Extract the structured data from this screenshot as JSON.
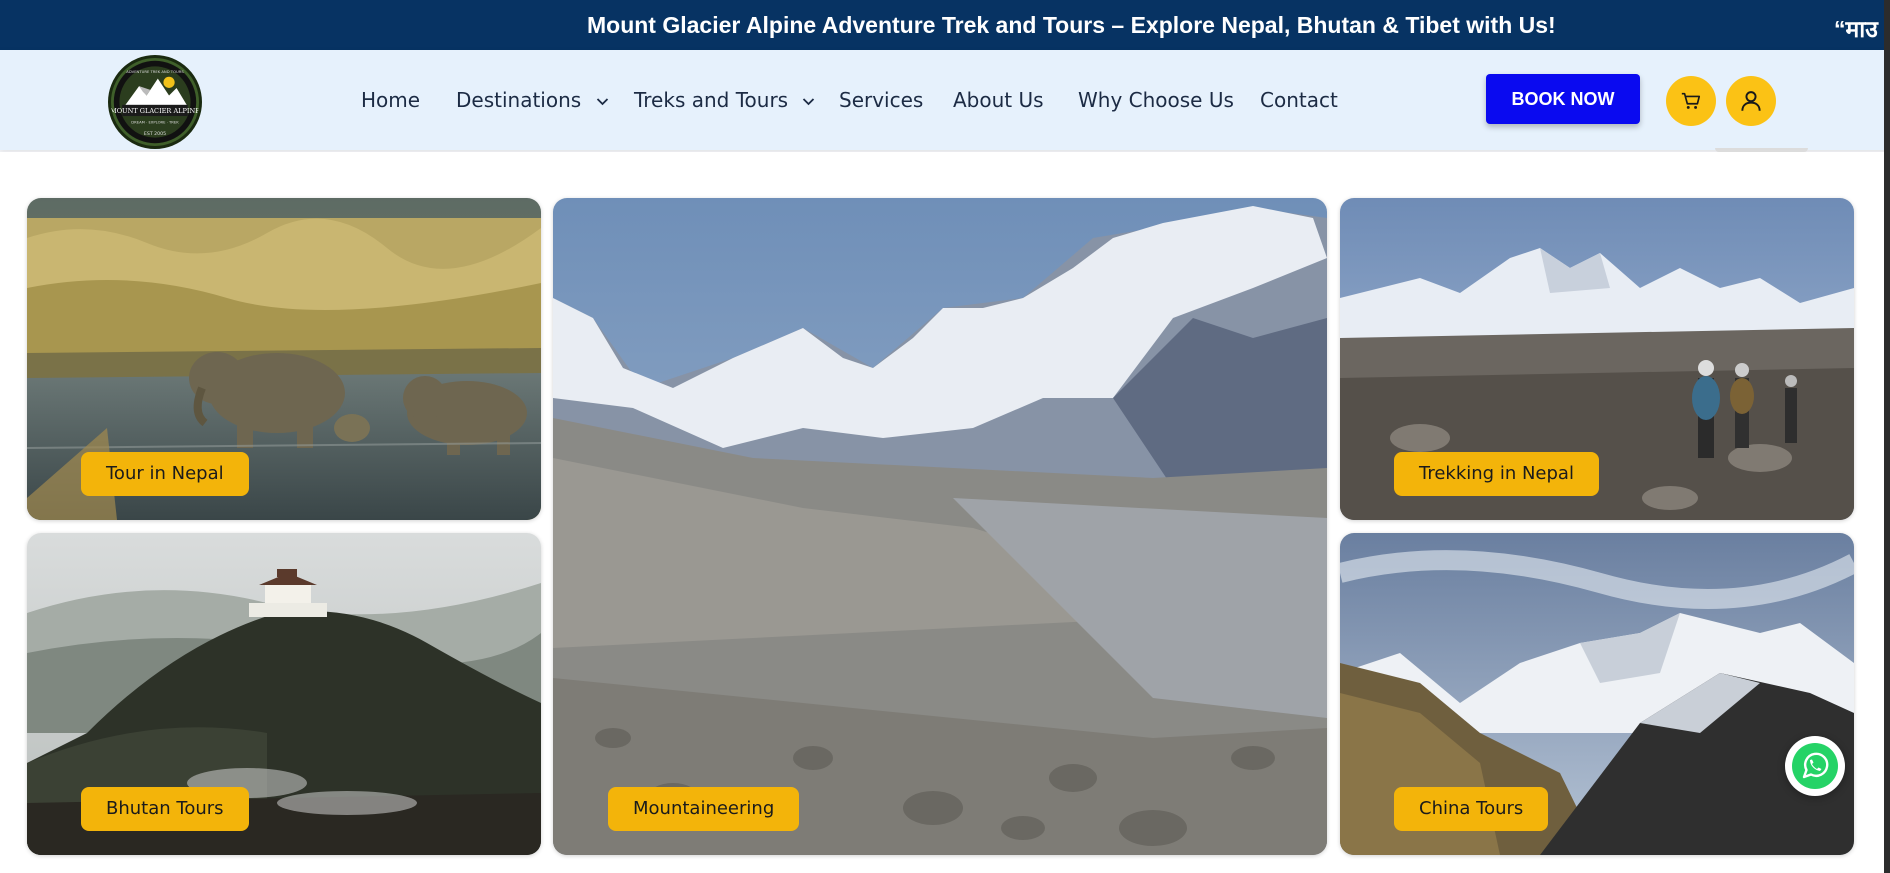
{
  "announcement": {
    "text": "Mount Glacier Alpine Adventure Trek and Tours – Explore Nepal, Bhutan & Tibet with Us!",
    "next_text": "“माउ"
  },
  "logo": {
    "top_text": "ADVENTURE TREK AND TOURS",
    "name": "MOUNT GLACIER ALPINE",
    "tagline": "DREAM · EXPLORE · TREK",
    "est": "EST 2005"
  },
  "nav": {
    "items": [
      {
        "label": "Home",
        "has_dropdown": false
      },
      {
        "label": "Destinations",
        "has_dropdown": true
      },
      {
        "label": "Treks and Tours",
        "has_dropdown": true
      },
      {
        "label": "Services",
        "has_dropdown": false
      },
      {
        "label": "About Us",
        "has_dropdown": false
      },
      {
        "label": "Why Choose Us",
        "has_dropdown": false
      },
      {
        "label": "Contact",
        "has_dropdown": false
      }
    ]
  },
  "actions": {
    "book_label": "BOOK NOW",
    "cart_icon": "cart-icon",
    "user_icon": "user-icon"
  },
  "cards": [
    {
      "label": "Tour in Nepal",
      "scene": "elephants in river"
    },
    {
      "label": "Mountaineering",
      "scene": "glacier valley with snowy peaks"
    },
    {
      "label": "Trekking in Nepal",
      "scene": "trekkers on rocky trail"
    },
    {
      "label": "Bhutan Tours",
      "scene": "monastery on misty hill"
    },
    {
      "label": "China Tours",
      "scene": "everest ridge"
    }
  ],
  "colors": {
    "ticker_bg": "#073363",
    "header_bg": "#e6f1fc",
    "book_btn": "#0a0af0",
    "accent_yellow": "#fbc215",
    "badge": "#f3b40a",
    "whatsapp": "#25d366"
  }
}
